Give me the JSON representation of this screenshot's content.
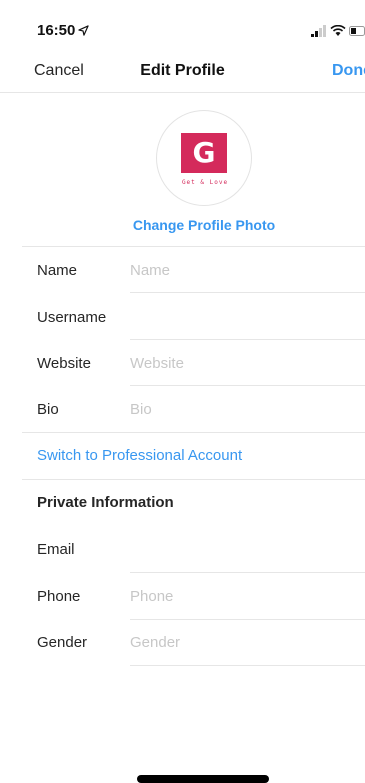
{
  "status_bar": {
    "time": "16:50"
  },
  "nav": {
    "cancel": "Cancel",
    "title": "Edit Profile",
    "done": "Done"
  },
  "profile": {
    "logo_letter": "G",
    "logo_tagline": "Get & Love",
    "change_photo": "Change Profile Photo",
    "brand_color": "#d42a5b"
  },
  "fields": {
    "name": {
      "label": "Name",
      "value": "",
      "placeholder": "Name"
    },
    "username": {
      "label": "Username",
      "value": "",
      "placeholder": ""
    },
    "website": {
      "label": "Website",
      "value": "",
      "placeholder": "Website"
    },
    "bio": {
      "label": "Bio",
      "value": "",
      "placeholder": "Bio"
    }
  },
  "switch_professional": "Switch to Professional Account",
  "private_info": {
    "title": "Private Information",
    "email": {
      "label": "Email",
      "value": "",
      "placeholder": ""
    },
    "phone": {
      "label": "Phone",
      "value": "",
      "placeholder": "Phone"
    },
    "gender": {
      "label": "Gender",
      "value": "",
      "placeholder": "Gender"
    }
  },
  "colors": {
    "accent": "#3897f0",
    "text": "#262626",
    "placeholder": "#c7c7c7",
    "divider": "#e6e6e6"
  },
  "icons": [
    "location-arrow-icon",
    "signal-icon",
    "wifi-icon",
    "battery-icon"
  ]
}
